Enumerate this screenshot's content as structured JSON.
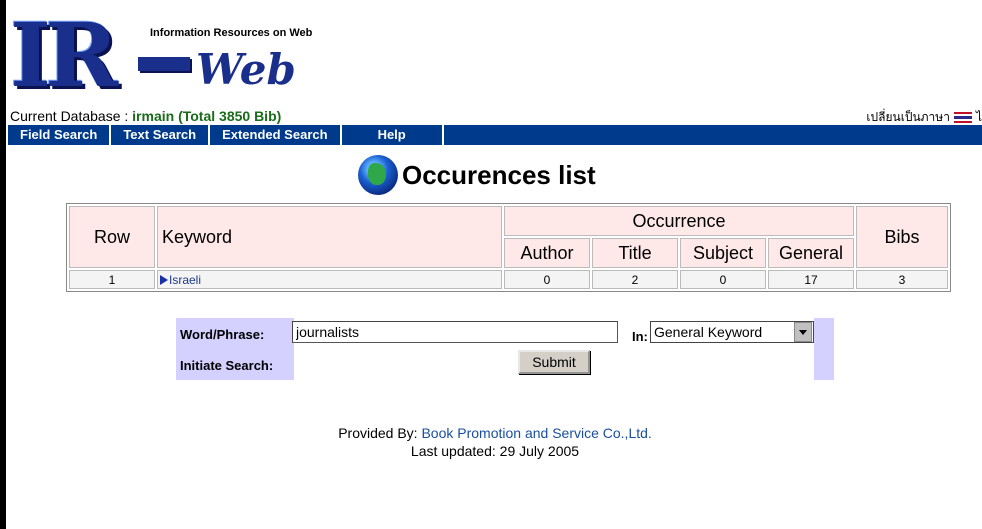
{
  "logo": {
    "big": "IR",
    "web": "Web",
    "tagline": "Information Resources on Web"
  },
  "database": {
    "prefix": "Current Database : ",
    "name": "irmain (Total 3850 Bib)"
  },
  "language": {
    "switch_label": "เปลี่ยนเป็นภาษา",
    "after_flag": "ไ"
  },
  "nav": [
    "Field Search",
    "Text Search",
    "Extended Search",
    "Help"
  ],
  "heading": "Occurences list",
  "table": {
    "headers": {
      "row": "Row",
      "keyword": "Keyword",
      "occurrence": "Occurrence",
      "bibs": "Bibs",
      "author": "Author",
      "title": "Title",
      "subject": "Subject",
      "general": "General"
    },
    "rows": [
      {
        "row": "1",
        "keyword": "Israeli",
        "author": "0",
        "title": "2",
        "subject": "0",
        "general": "17",
        "bibs": "3"
      }
    ]
  },
  "search": {
    "word_label": "Word/Phrase:",
    "word_value": "journalists",
    "in_label": "In:",
    "field_selected": "General Keyword",
    "initiate_label": "Initiate Search:",
    "submit_label": "Submit"
  },
  "footer": {
    "provided_prefix": "Provided By: ",
    "provider": "Book Promotion and Service Co.,Ltd.",
    "updated": "Last updated: 29 July 2005"
  }
}
